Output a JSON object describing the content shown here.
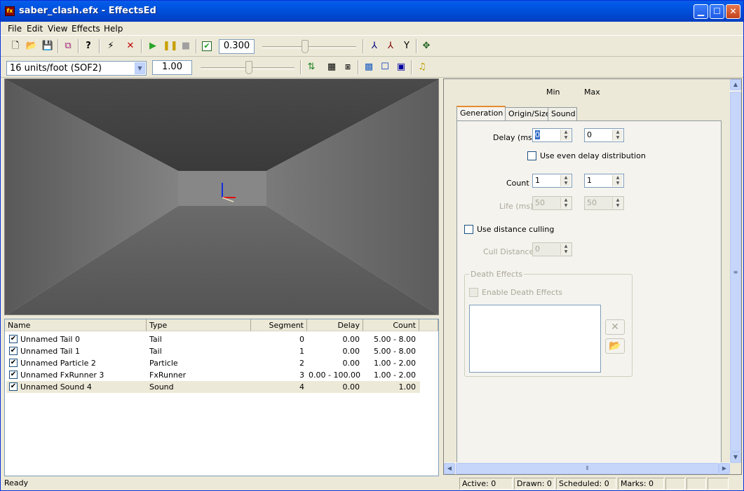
{
  "window": {
    "title": "saber_clash.efx - EffectsEd",
    "app_icon": "fx-icon"
  },
  "menu": [
    "File",
    "Edit",
    "View",
    "Effects",
    "Help"
  ],
  "toolbar1": {
    "time_value": "0.300",
    "time_slider_fraction": 0.45
  },
  "toolbar2": {
    "units_combo": "16 units/foot (SOF2)",
    "scale_value": "1.00",
    "scale_slider_fraction": 0.52
  },
  "list": {
    "headers": [
      "Name",
      "Type",
      "Segment",
      "Delay",
      "Count"
    ],
    "rows": [
      {
        "checked": true,
        "name": "Unnamed Tail 0",
        "type": "Tail",
        "segment": "0",
        "delay": "0.00",
        "count": "5.00 - 8.00",
        "selected": false
      },
      {
        "checked": true,
        "name": "Unnamed Tail 1",
        "type": "Tail",
        "segment": "1",
        "delay": "0.00",
        "count": "5.00 - 8.00",
        "selected": false
      },
      {
        "checked": true,
        "name": "Unnamed Particle 2",
        "type": "Particle",
        "segment": "2",
        "delay": "0.00",
        "count": "1.00 - 2.00",
        "selected": false
      },
      {
        "checked": true,
        "name": "Unnamed FxRunner 3",
        "type": "FxRunner",
        "segment": "3",
        "delay": "0.00 - 100.00",
        "count": "1.00 - 2.00",
        "selected": false
      },
      {
        "checked": true,
        "name": "Unnamed Sound 4",
        "type": "Sound",
        "segment": "4",
        "delay": "0.00",
        "count": "1.00",
        "selected": true
      }
    ]
  },
  "props": {
    "min_label": "Min",
    "max_label": "Max",
    "tabs": [
      "Generation",
      "Origin/Size",
      "Sound"
    ],
    "active_tab": "Generation",
    "delay_label": "Delay (ms)",
    "delay_min": "0",
    "delay_max": "0",
    "even_delay_label": "Use even delay distribution",
    "count_label": "Count",
    "count_min": "1",
    "count_max": "1",
    "life_label": "Life (ms)",
    "life_min": "50",
    "life_max": "50",
    "distance_culling_label": "Use distance culling",
    "cull_distance_label": "Cull Distance",
    "cull_distance_value": "0",
    "death_group_label": "Death Effects",
    "enable_death_label": "Enable Death Effects"
  },
  "status": {
    "text": "Ready",
    "active": "Active: 0",
    "drawn": "Drawn: 0",
    "scheduled": "Scheduled: 0",
    "marks": "Marks: 0"
  }
}
